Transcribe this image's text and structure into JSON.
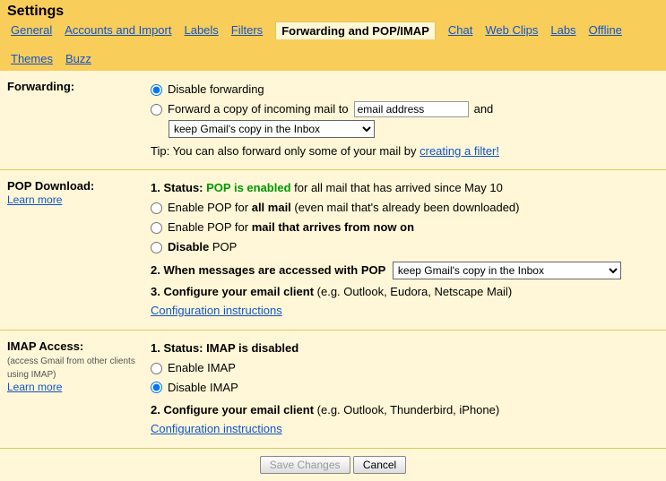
{
  "title": "Settings",
  "tabs": [
    "General",
    "Accounts and Import",
    "Labels",
    "Filters",
    "Forwarding and POP/IMAP",
    "Chat",
    "Web Clips",
    "Labs",
    "Offline",
    "Themes",
    "Buzz"
  ],
  "active_tab": "Forwarding and POP/IMAP",
  "forwarding": {
    "label": "Forwarding:",
    "opt_disable": "Disable forwarding",
    "opt_forward_pre": "Forward a copy of incoming mail to",
    "opt_forward_post": "and",
    "email_placeholder": "email address",
    "keep_select": "keep Gmail's copy in the Inbox",
    "tip_pre": "Tip: You can also forward only some of your mail by ",
    "tip_link": "creating a filter!"
  },
  "pop": {
    "label": "POP Download:",
    "learn_more": "Learn more",
    "status_num": "1. Status: ",
    "status_green": "POP is enabled",
    "status_rest": " for all mail that has arrived since May 10",
    "opt1a": "Enable POP for ",
    "opt1b": "all mail",
    "opt1c": " (even mail that's already been downloaded)",
    "opt2a": "Enable POP for ",
    "opt2b": "mail that arrives from now on",
    "opt3a": "Disable",
    "opt3b": " POP",
    "when_label": "2. When messages are accessed with POP",
    "when_select": "keep Gmail's copy in the Inbox",
    "conf_label": "3. Configure your email client",
    "conf_rest": " (e.g. Outlook, Eudora, Netscape Mail)",
    "conf_link": "Configuration instructions"
  },
  "imap": {
    "label": "IMAP Access:",
    "sub": "(access Gmail from other clients using IMAP)",
    "learn_more": "Learn more",
    "status_num": "1. Status: ",
    "status_text": "IMAP is disabled",
    "opt1": "Enable IMAP",
    "opt2": "Disable IMAP",
    "conf_label": "2. Configure your email client",
    "conf_rest": " (e.g. Outlook, Thunderbird, iPhone)",
    "conf_link": "Configuration instructions"
  },
  "footer": {
    "save": "Save Changes",
    "cancel": "Cancel"
  }
}
